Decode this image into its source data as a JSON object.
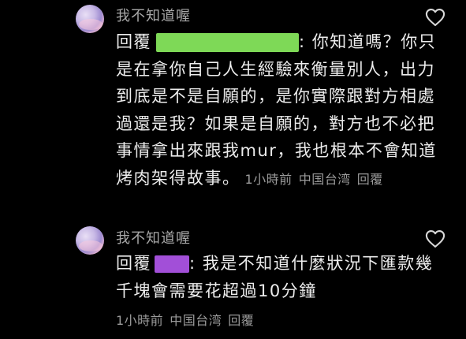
{
  "comments": [
    {
      "username": "我不知道喔",
      "reply_prefix": "回覆",
      "redaction_color": "#7ed957",
      "text_after_mention": ": 你知道嗎？你只是在拿你自己人生經驗來衡量別人，出力到底是不是自願的，是你實際跟對方相處過還是我？如果是自願的，對方也不必把事情拿出來跟我mur，我也根本不會知道烤肉架得故事。",
      "time": "1小時前",
      "location": "中国台湾",
      "reply_label": "回覆"
    },
    {
      "username": "我不知道喔",
      "reply_prefix": "回覆",
      "redaction_color": "#a24fd8",
      "text_after_mention": ": 我是不知道什麼狀況下匯款幾千塊會需要花超過10分鐘",
      "time": "1小時前",
      "location": "中国台湾",
      "reply_label": "回覆"
    }
  ],
  "icons": {
    "like": "heart-outline-icon",
    "avatar": "avatar-image"
  },
  "colors": {
    "background": "#000000",
    "text": "#ececec",
    "secondary": "#9a9a9a"
  }
}
